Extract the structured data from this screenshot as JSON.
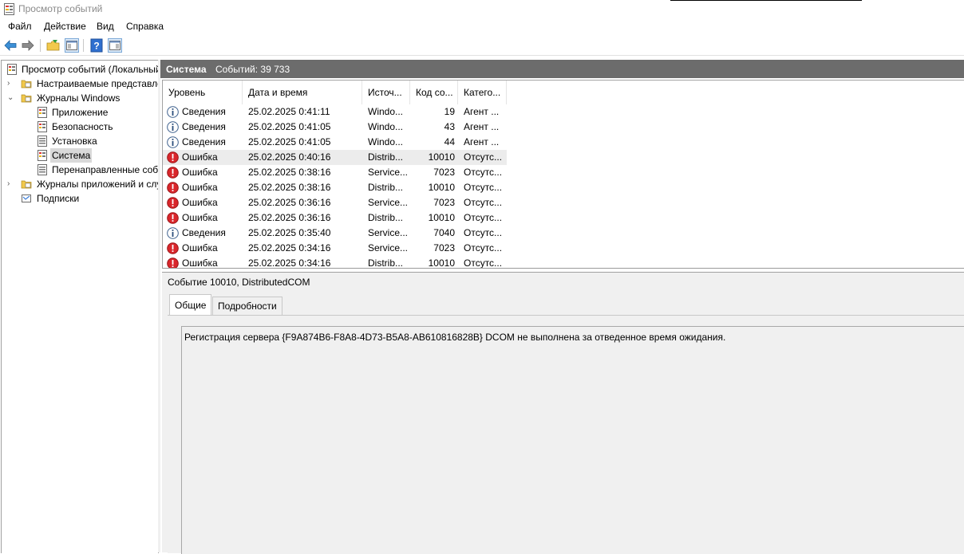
{
  "window": {
    "title": "Просмотр событий"
  },
  "menu": [
    "Файл",
    "Действие",
    "Вид",
    "Справка"
  ],
  "toolbar": {
    "buttons": [
      "back-arrow-icon",
      "forward-arrow-icon",
      "open-folder-icon",
      "show-pane-icon",
      "help-icon",
      "action-pane-icon"
    ]
  },
  "tree": {
    "items": [
      {
        "label": "Просмотр событий (Локальный)",
        "level": 0,
        "expander": ""
      },
      {
        "label": "Настраиваемые представления",
        "level": 1,
        "expander": "›"
      },
      {
        "label": "Журналы Windows",
        "level": 1,
        "expander": "⌄"
      },
      {
        "label": "Приложение",
        "level": 2,
        "expander": ""
      },
      {
        "label": "Безопасность",
        "level": 2,
        "expander": ""
      },
      {
        "label": "Установка",
        "level": 2,
        "expander": ""
      },
      {
        "label": "Система",
        "level": 2,
        "expander": ""
      },
      {
        "label": "Перенаправленные события",
        "level": 2,
        "expander": ""
      },
      {
        "label": "Журналы приложений и служб",
        "level": 1,
        "expander": "›"
      },
      {
        "label": "Подписки",
        "level": 1,
        "expander": ""
      }
    ]
  },
  "log": {
    "name": "Система",
    "count": "Событий: 39 733"
  },
  "grid": {
    "columns": [
      "Уровень",
      "Дата и время",
      "Источ...",
      "Код со...",
      "Катего..."
    ],
    "rows": [
      {
        "level": "Сведения",
        "type": "info",
        "date": "25.02.2025 0:41:11",
        "source": "Windo...",
        "code": "19",
        "category": "Агент ..."
      },
      {
        "level": "Сведения",
        "type": "info",
        "date": "25.02.2025 0:41:05",
        "source": "Windo...",
        "code": "43",
        "category": "Агент ..."
      },
      {
        "level": "Сведения",
        "type": "info",
        "date": "25.02.2025 0:41:05",
        "source": "Windo...",
        "code": "44",
        "category": "Агент ..."
      },
      {
        "level": "Ошибка",
        "type": "error",
        "date": "25.02.2025 0:40:16",
        "source": "Distrib...",
        "code": "10010",
        "category": "Отсутс..."
      },
      {
        "level": "Ошибка",
        "type": "error",
        "date": "25.02.2025 0:38:16",
        "source": "Service...",
        "code": "7023",
        "category": "Отсутс..."
      },
      {
        "level": "Ошибка",
        "type": "error",
        "date": "25.02.2025 0:38:16",
        "source": "Distrib...",
        "code": "10010",
        "category": "Отсутс..."
      },
      {
        "level": "Ошибка",
        "type": "error",
        "date": "25.02.2025 0:36:16",
        "source": "Service...",
        "code": "7023",
        "category": "Отсутс..."
      },
      {
        "level": "Ошибка",
        "type": "error",
        "date": "25.02.2025 0:36:16",
        "source": "Distrib...",
        "code": "10010",
        "category": "Отсутс..."
      },
      {
        "level": "Сведения",
        "type": "info",
        "date": "25.02.2025 0:35:40",
        "source": "Service...",
        "code": "7040",
        "category": "Отсутс..."
      },
      {
        "level": "Ошибка",
        "type": "error",
        "date": "25.02.2025 0:34:16",
        "source": "Service...",
        "code": "7023",
        "category": "Отсутс..."
      },
      {
        "level": "Ошибка",
        "type": "error",
        "date": "25.02.2025 0:34:16",
        "source": "Distrib...",
        "code": "10010",
        "category": "Отсутс..."
      }
    ]
  },
  "detail": {
    "title": "Событие 10010, DistributedCOM",
    "tabs": [
      "Общие",
      "Подробности"
    ],
    "message": "Регистрация сервера {F9A874B6-F8A8-4D73-B5A8-AB610816828B} DCOM не выполнена за отведенное время ожидания."
  },
  "colors": {
    "error": "#d9262b",
    "info": "#ffffff",
    "header": "#6c6c6c",
    "selected_row": "#ececec"
  }
}
